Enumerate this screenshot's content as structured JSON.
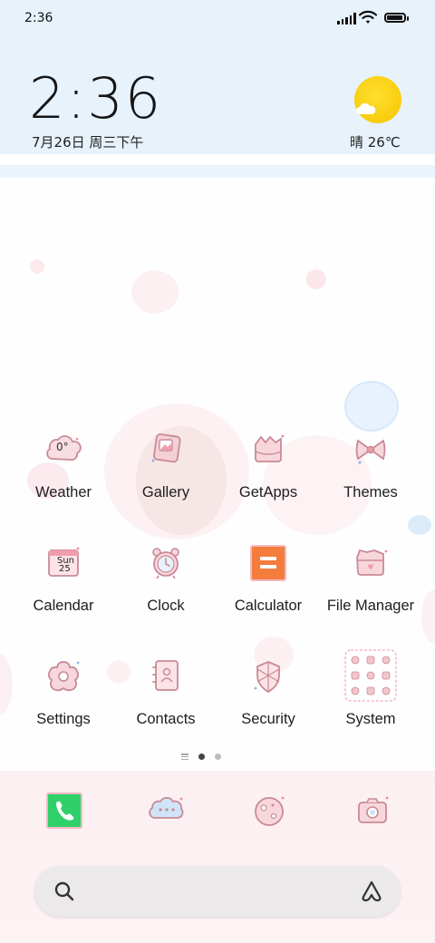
{
  "status_bar": {
    "time": "2:36",
    "battery_level": 0.95
  },
  "clock_widget": {
    "time": "2:36",
    "date": "7月26日 周三下午",
    "weather": "晴 26℃",
    "weather_icon": "sun-cloud-icon"
  },
  "apps": [
    {
      "label": "Weather",
      "icon": "weather-cloud-icon",
      "badge": "0°"
    },
    {
      "label": "Gallery",
      "icon": "gallery-photo-icon"
    },
    {
      "label": "GetApps",
      "icon": "getapps-bag-icon"
    },
    {
      "label": "Themes",
      "icon": "themes-bow-icon"
    },
    {
      "label": "Calendar",
      "icon": "calendar-icon",
      "badge_day": "Sun",
      "badge_date": "25"
    },
    {
      "label": "Clock",
      "icon": "alarm-clock-icon"
    },
    {
      "label": "Calculator",
      "icon": "calculator-icon"
    },
    {
      "label": "File Manager",
      "icon": "folder-icon"
    },
    {
      "label": "Settings",
      "icon": "settings-flower-icon"
    },
    {
      "label": "Contacts",
      "icon": "contacts-book-icon"
    },
    {
      "label": "Security",
      "icon": "security-shield-icon"
    },
    {
      "label": "System",
      "icon": "system-folder-icon"
    }
  ],
  "dock": [
    {
      "name": "phone",
      "icon": "phone-icon"
    },
    {
      "name": "messages",
      "icon": "message-cloud-icon"
    },
    {
      "name": "browser",
      "icon": "browser-planet-icon"
    },
    {
      "name": "camera",
      "icon": "camera-icon"
    }
  ],
  "pager": {
    "pages": 2,
    "current": 1
  },
  "search": {
    "placeholder": ""
  },
  "colors": {
    "top_band": "#e7f2fb",
    "sun": "#f6c400",
    "icon_pink": "#f2c6cd",
    "icon_outline": "#c98a96",
    "calculator_orange": "#f47c3c",
    "phone_green": "#2fd06a",
    "search_bg": "#ece9ea"
  }
}
